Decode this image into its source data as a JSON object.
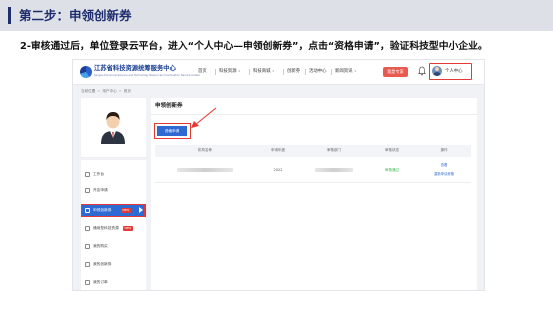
{
  "slide": {
    "title": "第二步：申领创新券",
    "instruction": "2-审核通过后，单位登录云平台，进入“个人中心—申领创新券”，点击“资格申请”，验证科技型中小企业。"
  },
  "portal": {
    "logo_title": "江苏省科技资源统筹服务中心",
    "logo_subtitle": "Jiangsu Provincial Science and Technology Resources Coordination Service Center",
    "nav": [
      {
        "label": "首页",
        "has_caret": false
      },
      {
        "label": "科技资源",
        "has_caret": true
      },
      {
        "label": "科技商城",
        "has_caret": true
      },
      {
        "label": "创新券",
        "has_caret": false
      },
      {
        "label": "活动中心",
        "has_caret": false
      },
      {
        "label": "新闻资讯",
        "has_caret": true
      }
    ],
    "nav_button": "我是专家",
    "user_center_label": "个人中心",
    "breadcrumb": [
      "当前位置",
      "用户中心",
      "首页"
    ],
    "sidebar": [
      {
        "label": "工作台",
        "new": false,
        "active": false
      },
      {
        "label": "开店申请",
        "new": false,
        "active": false
      },
      {
        "label": "申领创新券",
        "new": true,
        "active": true
      },
      {
        "label": "通用型科技资源",
        "new": true,
        "active": false
      },
      {
        "label": "我的购买",
        "new": false,
        "active": false
      },
      {
        "label": "我的创新券",
        "new": false,
        "active": false
      },
      {
        "label": "我的订单",
        "new": false,
        "active": false
      }
    ],
    "new_badge": "NEW",
    "main": {
      "title": "申领创新券",
      "apply_button": "资格申请",
      "columns": [
        "机构名称",
        "申请年度",
        "审核部门",
        "审核状态",
        "操作"
      ],
      "row": {
        "year": "2022",
        "status": "审核通过",
        "actions": [
          "查看",
          "重新申请资格"
        ]
      }
    },
    "colors": {
      "primary": "#2f6ad2",
      "highlight": "#e53935",
      "approved": "#3bb34a",
      "header_bar": "#dde1e7"
    }
  }
}
